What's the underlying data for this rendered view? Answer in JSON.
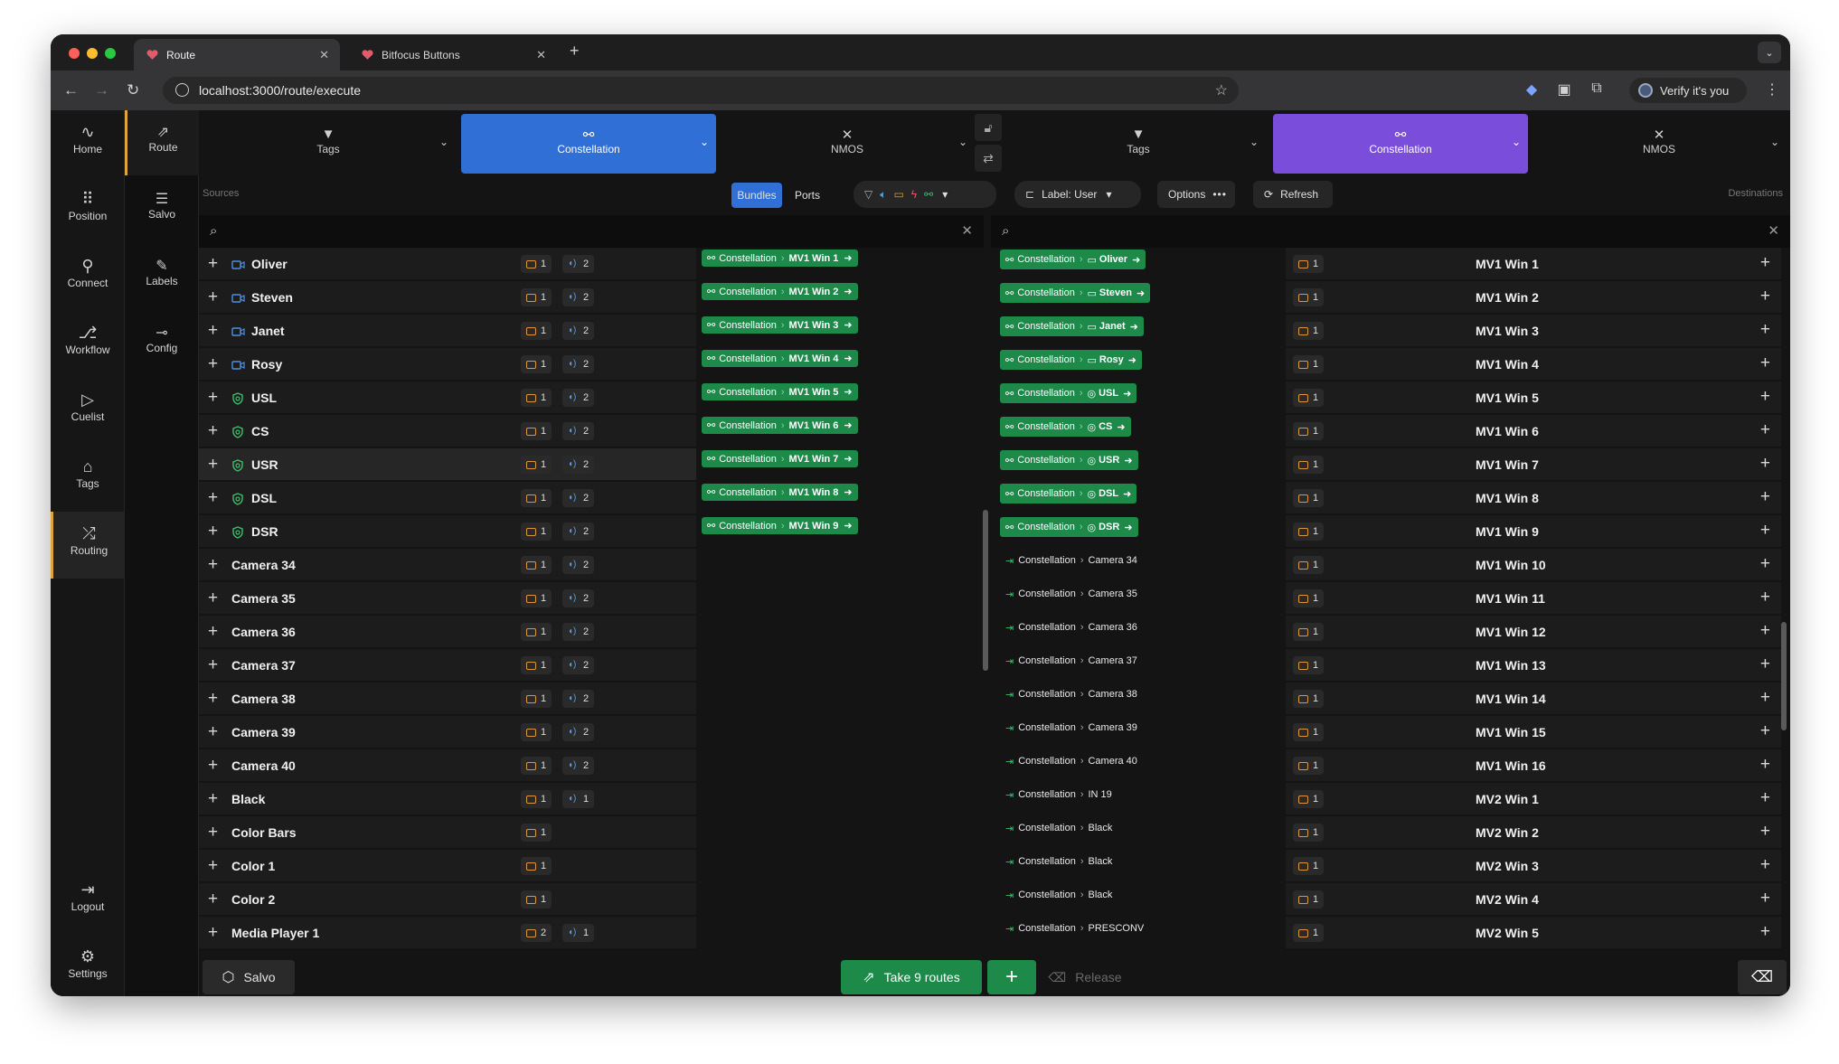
{
  "browser": {
    "tabs": [
      {
        "label": "Route",
        "active": true
      },
      {
        "label": "Bitfocus Buttons",
        "active": false
      }
    ],
    "url": "localhost:3000/route/execute",
    "profile_label": "Verify it's you"
  },
  "left_nav": [
    {
      "label": "Home",
      "icon": "pulse-icon"
    },
    {
      "label": "Position",
      "icon": "grid-icon"
    },
    {
      "label": "Connect",
      "icon": "plug-icon"
    },
    {
      "label": "Workflow",
      "icon": "workflow-icon"
    },
    {
      "label": "Cuelist",
      "icon": "play-icon"
    },
    {
      "label": "Tags",
      "icon": "tag-icon"
    },
    {
      "label": "Routing",
      "icon": "shuffle-icon",
      "active": true
    },
    {
      "label": "Logout",
      "icon": "logout-icon"
    },
    {
      "label": "Settings",
      "icon": "gear-icon"
    }
  ],
  "sub_nav": [
    {
      "label": "Route",
      "active": true
    },
    {
      "label": "Salvo"
    },
    {
      "label": "Labels"
    },
    {
      "label": "Config"
    }
  ],
  "filters": {
    "source": [
      "Tags",
      "Constellation",
      "NMOS"
    ],
    "destination": [
      "Tags",
      "Constellation",
      "NMOS"
    ]
  },
  "toolbar": {
    "sources_label": "Sources",
    "destinations_label": "Destinations",
    "bundles": "Bundles",
    "ports": "Ports",
    "label_select": "Label: User",
    "options": "Options",
    "refresh": "Refresh"
  },
  "rows": [
    {
      "src": "Oliver",
      "type": "cam",
      "v": "1",
      "a": "2",
      "pend": "MV1 Win 1",
      "cur": "Oliver",
      "curType": "cam",
      "dv": "1",
      "dst": "MV1 Win 1"
    },
    {
      "src": "Steven",
      "type": "cam",
      "v": "1",
      "a": "2",
      "pend": "MV1 Win 2",
      "cur": "Steven",
      "curType": "cam",
      "dv": "1",
      "dst": "MV1 Win 2"
    },
    {
      "src": "Janet",
      "type": "cam",
      "v": "1",
      "a": "2",
      "pend": "MV1 Win 3",
      "cur": "Janet",
      "curType": "cam",
      "dv": "1",
      "dst": "MV1 Win 3"
    },
    {
      "src": "Rosy",
      "type": "cam",
      "v": "1",
      "a": "2",
      "pend": "MV1 Win 4",
      "cur": "Rosy",
      "curType": "cam",
      "dv": "1",
      "dst": "MV1 Win 4"
    },
    {
      "src": "USL",
      "type": "shield",
      "v": "1",
      "a": "2",
      "pend": "MV1 Win 5",
      "cur": "USL",
      "curType": "shield",
      "dv": "1",
      "dst": "MV1 Win 5"
    },
    {
      "src": "CS",
      "type": "shield",
      "v": "1",
      "a": "2",
      "pend": "MV1 Win 6",
      "cur": "CS",
      "curType": "shield",
      "dv": "1",
      "dst": "MV1 Win 6"
    },
    {
      "src": "USR",
      "type": "shield",
      "v": "1",
      "a": "2",
      "pend": "MV1 Win 7",
      "cur": "USR",
      "curType": "shield",
      "dv": "1",
      "dst": "MV1 Win 7",
      "hl": true
    },
    {
      "src": "DSL",
      "type": "shield",
      "v": "1",
      "a": "2",
      "pend": "MV1 Win 8",
      "cur": "DSL",
      "curType": "shield",
      "dv": "1",
      "dst": "MV1 Win 8"
    },
    {
      "src": "DSR",
      "type": "shield",
      "v": "1",
      "a": "2",
      "pend": "MV1 Win 9",
      "cur": "DSR",
      "curType": "shield",
      "dv": "1",
      "dst": "MV1 Win 9"
    },
    {
      "src": "Camera 34",
      "v": "1",
      "a": "2",
      "cur": "Camera 34",
      "dv": "1",
      "dst": "MV1 Win 10"
    },
    {
      "src": "Camera 35",
      "v": "1",
      "a": "2",
      "cur": "Camera 35",
      "dv": "1",
      "dst": "MV1 Win 11"
    },
    {
      "src": "Camera 36",
      "v": "1",
      "a": "2",
      "cur": "Camera 36",
      "dv": "1",
      "dst": "MV1 Win 12"
    },
    {
      "src": "Camera 37",
      "v": "1",
      "a": "2",
      "cur": "Camera 37",
      "dv": "1",
      "dst": "MV1 Win 13"
    },
    {
      "src": "Camera 38",
      "v": "1",
      "a": "2",
      "cur": "Camera 38",
      "dv": "1",
      "dst": "MV1 Win 14"
    },
    {
      "src": "Camera 39",
      "v": "1",
      "a": "2",
      "cur": "Camera 39",
      "dv": "1",
      "dst": "MV1 Win 15"
    },
    {
      "src": "Camera 40",
      "v": "1",
      "a": "2",
      "cur": "Camera 40",
      "dv": "1",
      "dst": "MV1 Win 16"
    },
    {
      "src": "Black",
      "v": "1",
      "a": "1",
      "cur": "IN 19",
      "dv": "1",
      "dst": "MV2 Win 1"
    },
    {
      "src": "Color Bars",
      "v": "1",
      "cur": "Black",
      "dv": "1",
      "dst": "MV2 Win 2"
    },
    {
      "src": "Color 1",
      "v": "1",
      "cur": "Black",
      "dv": "1",
      "dst": "MV2 Win 3"
    },
    {
      "src": "Color 2",
      "v": "1",
      "cur": "Black",
      "dv": "1",
      "dst": "MV2 Win 4"
    },
    {
      "src": "Media Player 1",
      "v": "2",
      "a": "1",
      "cur": "PRESCONV",
      "dv": "1",
      "dst": "MV2 Win 5"
    }
  ],
  "route_device": "Constellation",
  "bottom": {
    "salvo": "Salvo",
    "take": "Take 9 routes",
    "release": "Release"
  },
  "colors": {
    "accent_blue": "#2f6fd6",
    "accent_purple": "#7b4ddb",
    "route_green": "#1d8a4a",
    "nav_highlight": "#e0a53a"
  }
}
